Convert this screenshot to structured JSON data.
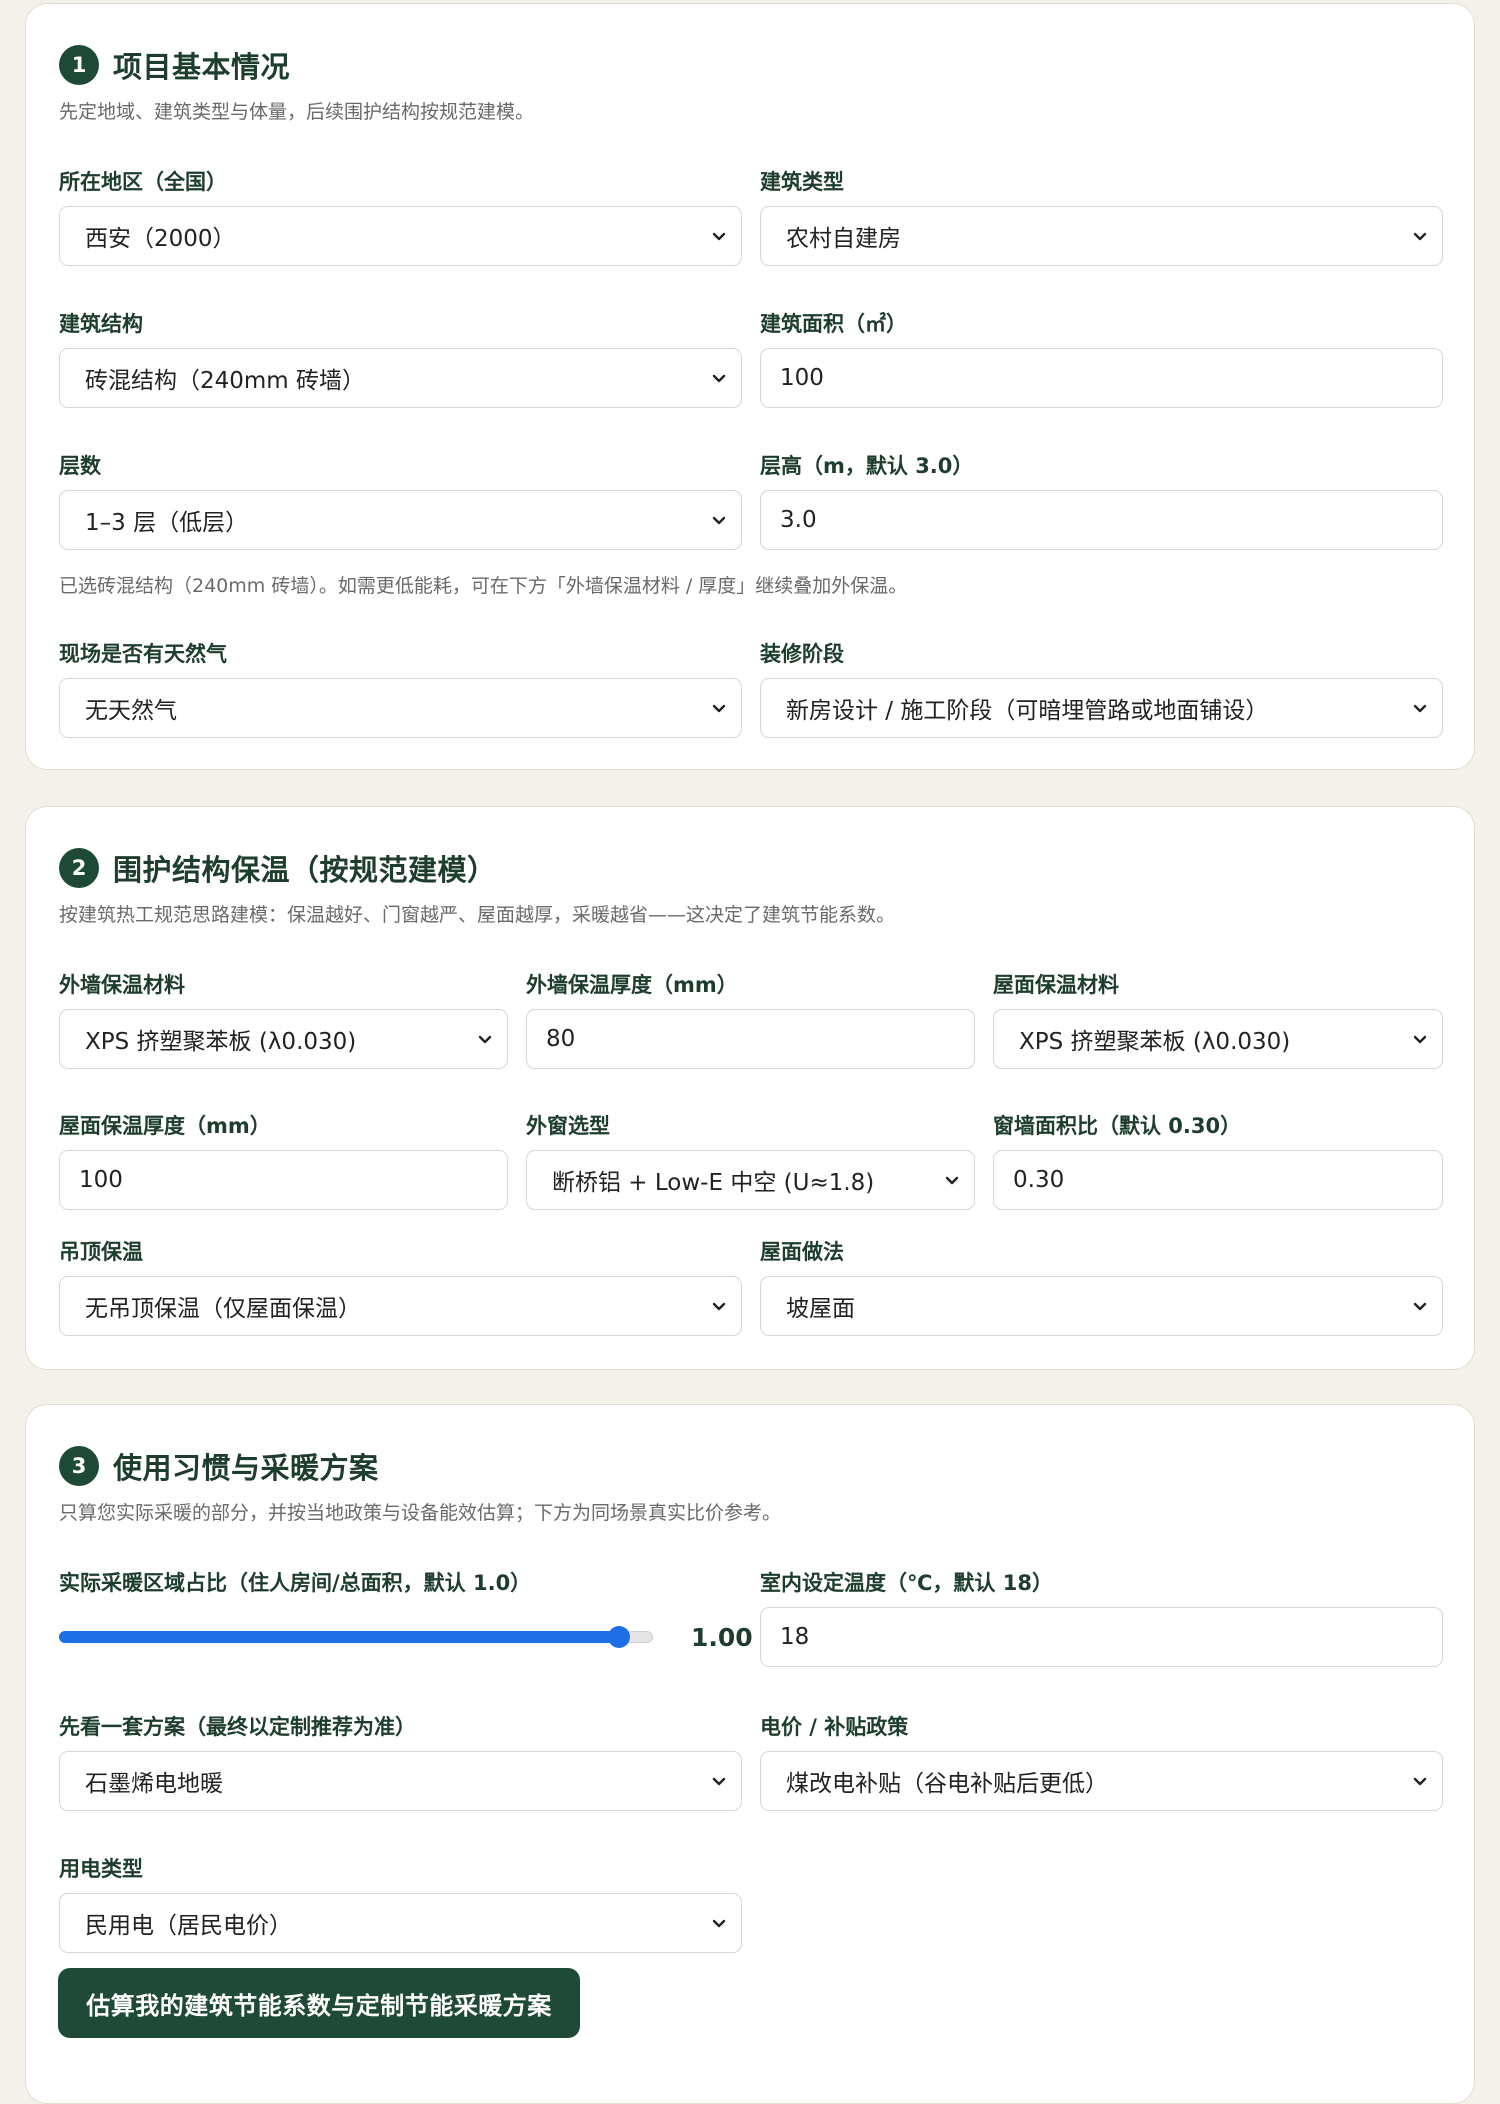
{
  "sections": [
    {
      "number": "1",
      "title": "项目基本情况",
      "desc": "先定地域、建筑类型与体量，后续围护结构按规范建模。",
      "fields": {
        "region": {
          "label": "所在地区（全国）",
          "value": "西安（2000）"
        },
        "building_type": {
          "label": "建筑类型",
          "value": "农村自建房"
        },
        "structure": {
          "label": "建筑结构",
          "value": "砖混结构（240mm 砖墙）"
        },
        "area": {
          "label": "建筑面积（㎡）",
          "value": "100"
        },
        "floors": {
          "label": "层数",
          "value": "1–3 层（低层）"
        },
        "floor_height": {
          "label": "层高（m，默认 3.0）",
          "value": "3.0"
        },
        "gas": {
          "label": "现场是否有天然气",
          "value": "无天然气"
        },
        "stage": {
          "label": "装修阶段",
          "value": "新房设计 / 施工阶段（可暗埋管路或地面铺设）"
        }
      },
      "note": "已选砖混结构（240mm 砖墙）。如需更低能耗，可在下方「外墙保温材料 / 厚度」继续叠加外保温。"
    },
    {
      "number": "2",
      "title": "围护结构保温（按规范建模）",
      "desc": "按建筑热工规范思路建模：保温越好、门窗越严、屋面越厚，采暖越省——这决定了建筑节能系数。",
      "fields": {
        "wall_material": {
          "label": "外墙保温材料",
          "value": "XPS 挤塑聚苯板 (λ0.030)"
        },
        "wall_thickness": {
          "label": "外墙保温厚度（mm）",
          "value": "80"
        },
        "roof_material": {
          "label": "屋面保温材料",
          "value": "XPS 挤塑聚苯板 (λ0.030)"
        },
        "roof_thickness": {
          "label": "屋面保温厚度（mm）",
          "value": "100"
        },
        "window": {
          "label": "外窗选型",
          "value": "断桥铝 + Low-E 中空 (U≈1.8)"
        },
        "window_ratio": {
          "label": "窗墙面积比（默认 0.30）",
          "value": "0.30"
        },
        "ceiling": {
          "label": "吊顶保温",
          "value": "无吊顶保温（仅屋面保温）"
        },
        "roof_type": {
          "label": "屋面做法",
          "value": "坡屋面"
        }
      }
    },
    {
      "number": "3",
      "title": "使用习惯与采暖方案",
      "desc": "只算您实际采暖的部分，并按当地政策与设备能效估算；下方为同场景真实比价参考。",
      "fields": {
        "heating_ratio": {
          "label": "实际采暖区域占比（住人房间/总面积，默认 1.0）",
          "value": "1.00",
          "level": 1.0
        },
        "indoor_temp": {
          "label": "室内设定温度（℃，默认 18）",
          "value": "18"
        },
        "plan": {
          "label": "先看一套方案（最终以定制推荐为准）",
          "value": "石墨烯电地暖"
        },
        "policy": {
          "label": "电价 / 补贴政策",
          "value": "煤改电补贴（谷电补贴后更低）"
        },
        "power_type": {
          "label": "用电类型",
          "value": "民用电（居民电价）"
        }
      },
      "submit_label": "估算我的建筑节能系数与定制节能采暖方案"
    }
  ],
  "colors": {
    "primary": "#1f4a37",
    "slider": "#1e6fe6",
    "background": "#f4f1ea"
  },
  "icons": {
    "select": "chevron-down-icon"
  }
}
